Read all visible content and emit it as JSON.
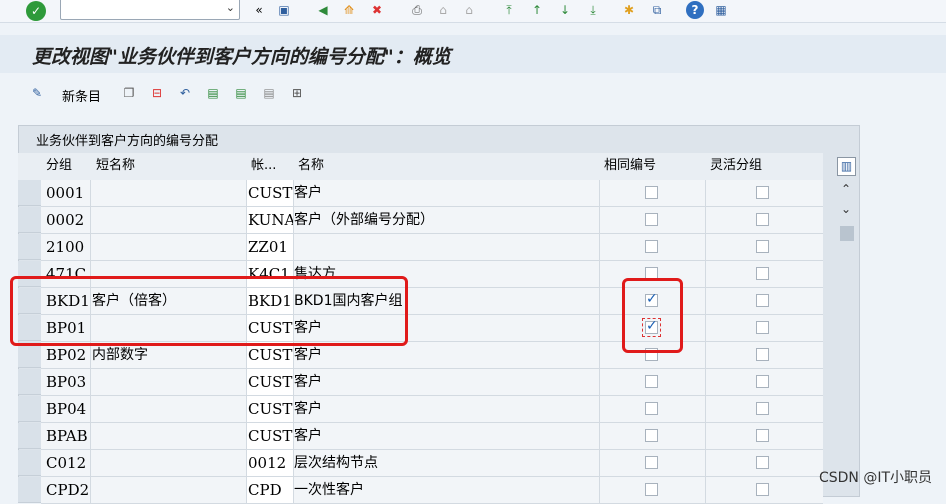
{
  "toolbar": {
    "command_value": ""
  },
  "title": "更改视图\"业务伙伴到客户方向的编号分配\"：概览",
  "app_toolbar": {
    "new_entries_label": "新条目"
  },
  "table": {
    "caption": "业务伙伴到客户方向的编号分配",
    "columns": [
      "分组",
      "短名称",
      "帐...",
      "名称",
      "相同编号",
      "灵活分组"
    ],
    "rows": [
      {
        "group": "0001",
        "short": "",
        "acct": "CUST",
        "name": "客户",
        "same": false,
        "flex": false
      },
      {
        "group": "0002",
        "short": "",
        "acct": "KUNA",
        "name": "客户（外部编号分配）",
        "same": false,
        "flex": false
      },
      {
        "group": "2100",
        "short": "",
        "acct": "ZZ01",
        "name": "",
        "same": false,
        "flex": false
      },
      {
        "group": "471C",
        "short": "",
        "acct": "K4C1",
        "name": "售达方",
        "same": false,
        "flex": false
      },
      {
        "group": "BKD1",
        "short": "客户（倍客）",
        "acct": "BKD1",
        "name": "BKD1国内客户组",
        "same": true,
        "flex": false
      },
      {
        "group": "BP01",
        "short": "",
        "acct": "CUST",
        "name": "客户",
        "same": true,
        "flex": false
      },
      {
        "group": "BP02",
        "short": "内部数字",
        "acct": "CUST",
        "name": "客户",
        "same": false,
        "flex": false
      },
      {
        "group": "BP03",
        "short": "",
        "acct": "CUST",
        "name": "客户",
        "same": false,
        "flex": false
      },
      {
        "group": "BP04",
        "short": "",
        "acct": "CUST",
        "name": "客户",
        "same": false,
        "flex": false
      },
      {
        "group": "BPAB",
        "short": "",
        "acct": "CUST",
        "name": "客户",
        "same": false,
        "flex": false
      },
      {
        "group": "C012",
        "short": "",
        "acct": "0012",
        "name": "层次结构节点",
        "same": false,
        "flex": false
      },
      {
        "group": "CPD2",
        "short": "",
        "acct": "CPD",
        "name": "一次性客户",
        "same": false,
        "flex": false
      }
    ]
  },
  "watermark": "CSDN @IT小职员",
  "colors": {
    "highlight": "#e01a1a",
    "check": "#1a5fb4"
  }
}
